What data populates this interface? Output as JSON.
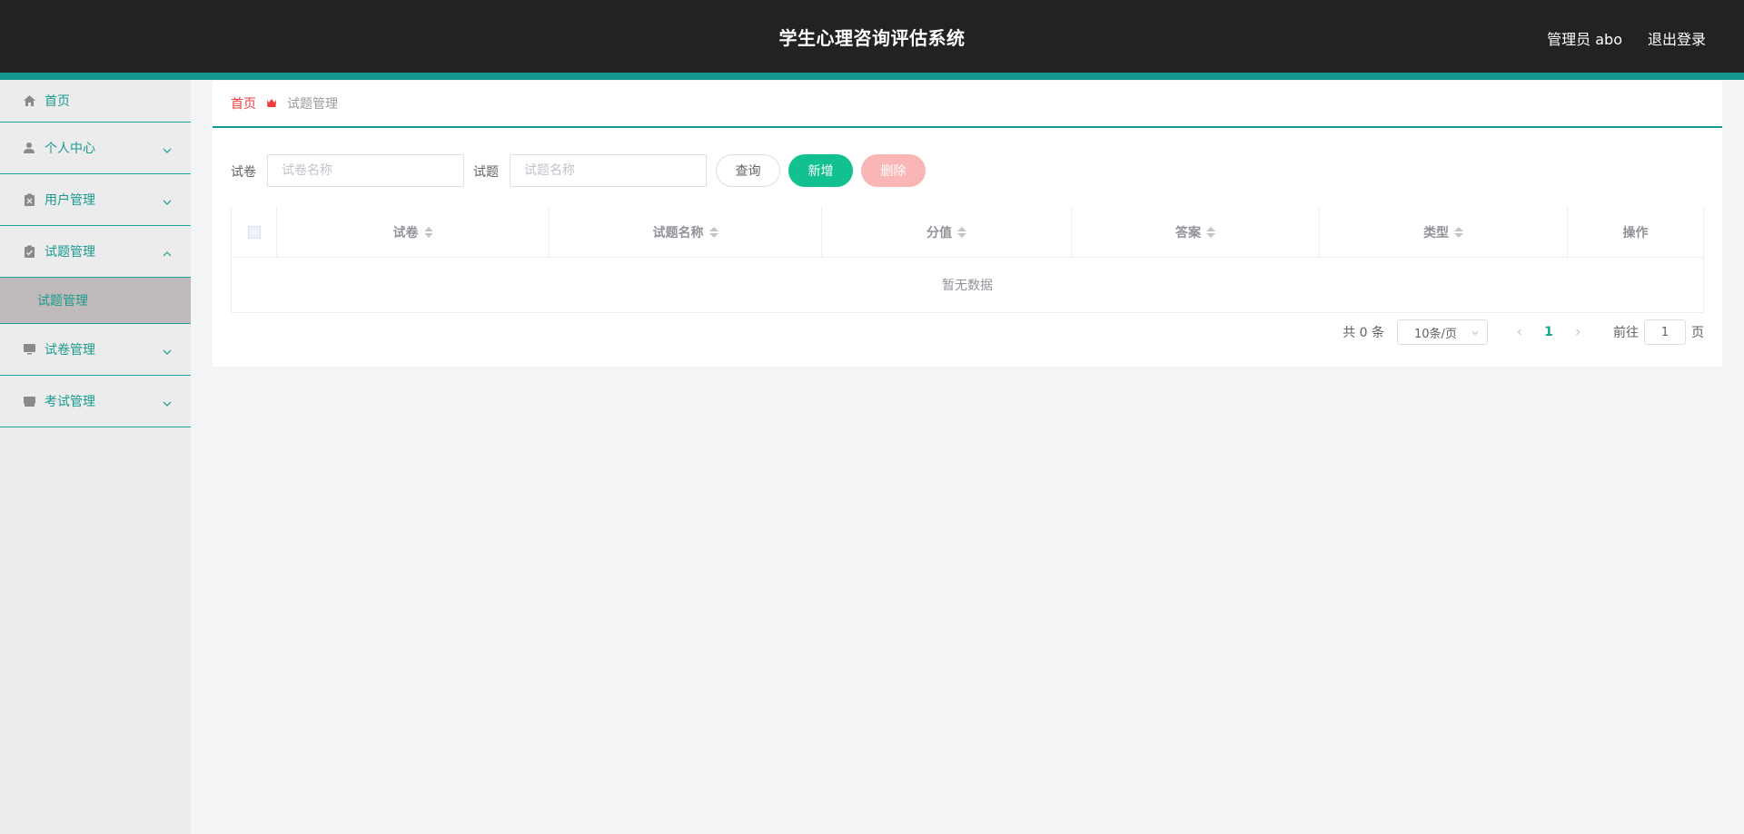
{
  "header": {
    "title": "学生心理咨询评估系统",
    "user": "管理员 abo",
    "logout": "退出登录"
  },
  "sidebar": {
    "items": [
      {
        "label": "首页",
        "icon": "home-icon"
      },
      {
        "label": "个人中心",
        "icon": "user-icon"
      },
      {
        "label": "用户管理",
        "icon": "clipboard-x-icon"
      },
      {
        "label": "试题管理",
        "icon": "clipboard-check-icon",
        "expanded": true,
        "children": [
          {
            "label": "试题管理"
          }
        ]
      },
      {
        "label": "试卷管理",
        "icon": "monitor-icon"
      },
      {
        "label": "考试管理",
        "icon": "inbox-icon"
      }
    ]
  },
  "breadcrumb": {
    "home": "首页",
    "current": "试题管理"
  },
  "search": {
    "paper_label": "试卷",
    "paper_placeholder": "试卷名称",
    "question_label": "试题",
    "question_placeholder": "试题名称",
    "query": "查询",
    "add": "新增",
    "delete": "删除"
  },
  "table": {
    "columns": [
      "试卷",
      "试题名称",
      "分值",
      "答案",
      "类型",
      "操作"
    ],
    "empty": "暂无数据"
  },
  "pagination": {
    "total": "共 0 条",
    "page_size": "10条/页",
    "current_page": "1",
    "goto_label": "前往",
    "goto_value": "1",
    "page_word": "页"
  },
  "colors": {
    "accent": "#14968c",
    "primary_button": "#13c190",
    "danger_button": "#fab6b6",
    "header_bg": "#222222"
  }
}
